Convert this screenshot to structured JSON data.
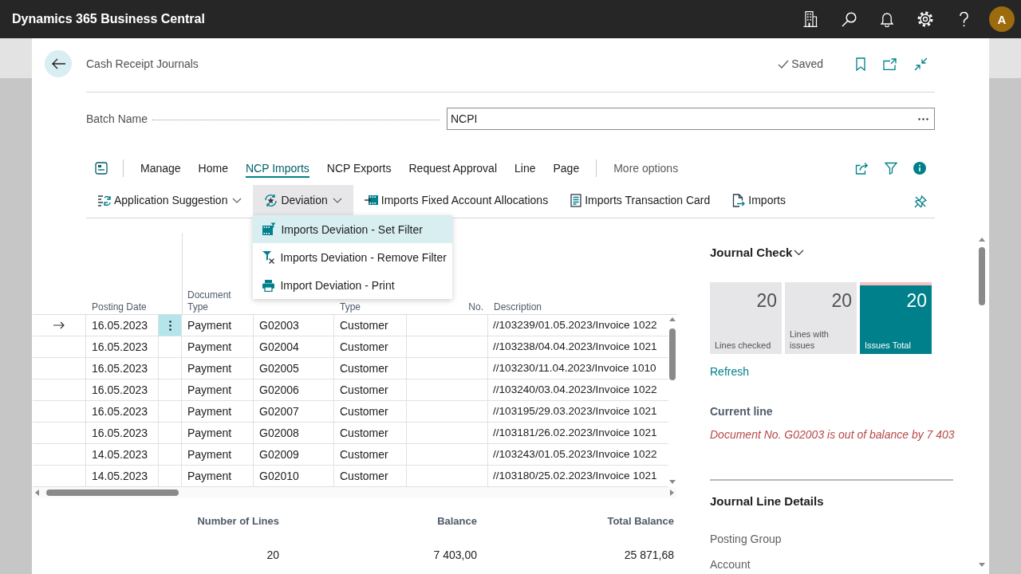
{
  "app_bar": {
    "title": "Dynamics 365 Business Central",
    "avatar": "A"
  },
  "page": {
    "title": "Cash Receipt Journals",
    "status": "Saved"
  },
  "batch": {
    "label": "Batch Name",
    "value": "NCPI"
  },
  "action_tabs": [
    {
      "label": "Manage",
      "selected": false
    },
    {
      "label": "Home",
      "selected": false
    },
    {
      "label": "NCP Imports",
      "selected": true
    },
    {
      "label": "NCP Exports",
      "selected": false
    },
    {
      "label": "Request Approval",
      "selected": false
    },
    {
      "label": "Line",
      "selected": false
    },
    {
      "label": "Page",
      "selected": false
    }
  ],
  "more_options": "More options",
  "actions": [
    {
      "label": "Application Suggestion",
      "kind": "dropdown",
      "expanded": false
    },
    {
      "label": "Deviation",
      "kind": "dropdown",
      "expanded": true,
      "menu": [
        {
          "label": "Imports Deviation - Set Filter",
          "selected": true
        },
        {
          "label": "Imports Deviation - Remove Filter",
          "selected": false
        },
        {
          "label": "Import Deviation - Print",
          "selected": false
        }
      ]
    },
    {
      "label": "Imports Fixed Account Allocations",
      "kind": "button"
    },
    {
      "label": "Imports Transaction Card",
      "kind": "button"
    },
    {
      "label": "Imports",
      "kind": "button"
    }
  ],
  "table": {
    "headers": {
      "posting_date": "Posting Date",
      "document_type": "Document Type",
      "type": "Type",
      "no": "No.",
      "description": "Description"
    },
    "rows": [
      {
        "current": true,
        "posting_date": "16.05.2023",
        "document_type": "Payment",
        "column_4": "G02003",
        "type": "Customer",
        "description": "//103239/01.05.2023/Invoice 1022"
      },
      {
        "current": false,
        "posting_date": "16.05.2023",
        "document_type": "Payment",
        "column_4": "G02004",
        "type": "Customer",
        "description": "//103238/04.04.2023/Invoice 1021"
      },
      {
        "current": false,
        "posting_date": "16.05.2023",
        "document_type": "Payment",
        "column_4": "G02005",
        "type": "Customer",
        "description": "//103230/11.04.2023/Invoice 1010"
      },
      {
        "current": false,
        "posting_date": "16.05.2023",
        "document_type": "Payment",
        "column_4": "G02006",
        "type": "Customer",
        "description": "//103240/03.04.2023/Invoice 1022"
      },
      {
        "current": false,
        "posting_date": "16.05.2023",
        "document_type": "Payment",
        "column_4": "G02007",
        "type": "Customer",
        "description": "//103195/29.03.2023/Invoice 1021"
      },
      {
        "current": false,
        "posting_date": "16.05.2023",
        "document_type": "Payment",
        "column_4": "G02008",
        "type": "Customer",
        "description": "//103181/26.02.2023/Invoice 1021"
      },
      {
        "current": false,
        "posting_date": "14.05.2023",
        "document_type": "Payment",
        "column_4": "G02009",
        "type": "Customer",
        "description": "//103243/01.05.2023/Invoice 1022"
      },
      {
        "current": false,
        "posting_date": "14.05.2023",
        "document_type": "Payment",
        "column_4": "G02010",
        "type": "Customer",
        "description": "//103180/25.02.2023/Invoice 1021"
      }
    ]
  },
  "totals": [
    {
      "label": "Number of Lines",
      "value": "20"
    },
    {
      "label": "Balance",
      "value": "7 403,00"
    },
    {
      "label": "Total Balance",
      "value": "25 871,68"
    }
  ],
  "journal_check": {
    "title": "Journal Check",
    "tiles": [
      {
        "value": "20",
        "label": "Lines checked",
        "kind": "neutral"
      },
      {
        "value": "20",
        "label": "Lines with issues",
        "kind": "neutral"
      },
      {
        "value": "20",
        "label": "Issues Total",
        "kind": "alert"
      }
    ],
    "refresh": "Refresh",
    "current_line_label": "Current line",
    "current_line_message": "Document No. G02003 is out of balance by 7 403"
  },
  "journal_line_details": {
    "title": "Journal Line Details",
    "fields": [
      "Posting Group",
      "Account"
    ]
  }
}
